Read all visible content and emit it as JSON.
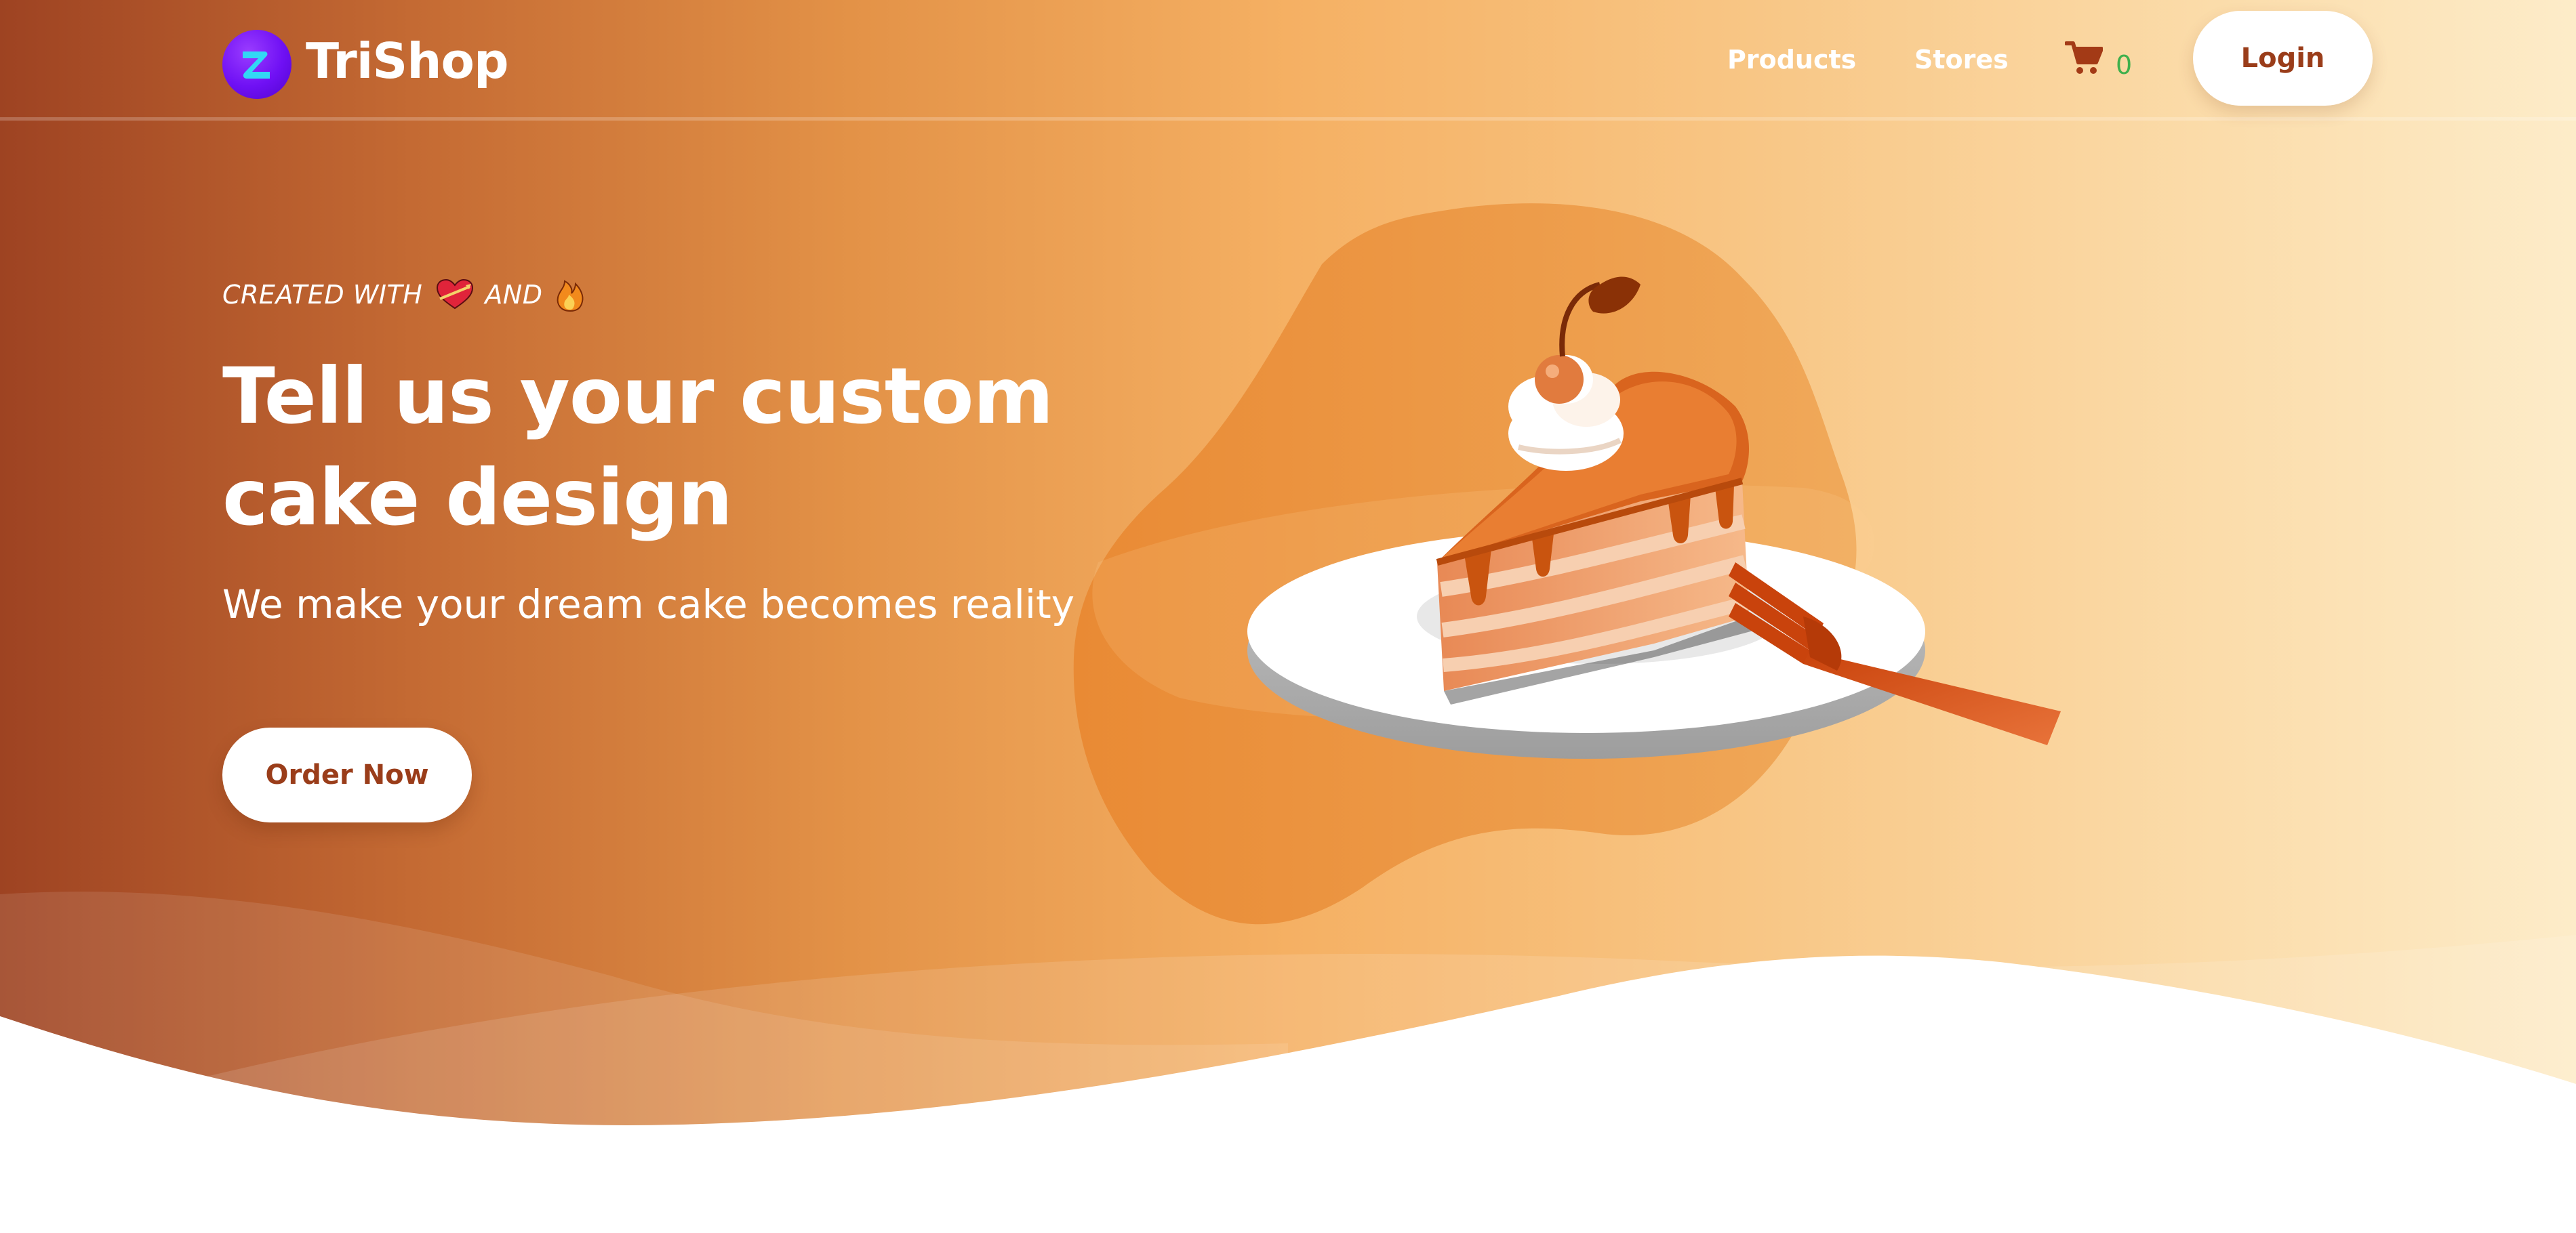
{
  "nav": {
    "brand": {
      "name": "TriShop",
      "logo_icon": "trishop-logo-icon"
    },
    "links": [
      {
        "label": "Products"
      },
      {
        "label": "Stores"
      }
    ],
    "cart": {
      "icon": "cart-icon",
      "count": "0",
      "count_color": "#3fb04c"
    },
    "login_label": "Login"
  },
  "hero": {
    "tagline_prefix": "CREATED WITH",
    "tagline_mid": "AND",
    "tagline_icons": [
      "heart-icon",
      "fire-icon"
    ],
    "headline": "Tell us your custom cake design",
    "subheadline": "We make your dream cake becomes reality",
    "cta_label": "Order Now",
    "illustration": "cake-slice-with-fork-illustration"
  },
  "colors": {
    "gradient_start": "#9e4322",
    "gradient_mid": "#f5b063",
    "gradient_end": "#fdecc9",
    "button_text": "#9a3d1a",
    "logo_bg": "#6f10f4",
    "logo_glyph": "#32d8f5"
  }
}
